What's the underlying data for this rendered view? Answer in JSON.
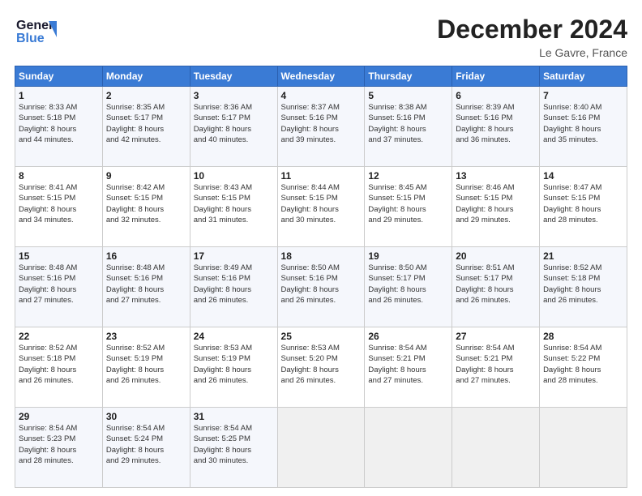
{
  "header": {
    "logo_line1": "General",
    "logo_line2": "Blue",
    "month": "December 2024",
    "location": "Le Gavre, France"
  },
  "days_of_week": [
    "Sunday",
    "Monday",
    "Tuesday",
    "Wednesday",
    "Thursday",
    "Friday",
    "Saturday"
  ],
  "weeks": [
    [
      {
        "day": "1",
        "info": "Sunrise: 8:33 AM\nSunset: 5:18 PM\nDaylight: 8 hours\nand 44 minutes."
      },
      {
        "day": "2",
        "info": "Sunrise: 8:35 AM\nSunset: 5:17 PM\nDaylight: 8 hours\nand 42 minutes."
      },
      {
        "day": "3",
        "info": "Sunrise: 8:36 AM\nSunset: 5:17 PM\nDaylight: 8 hours\nand 40 minutes."
      },
      {
        "day": "4",
        "info": "Sunrise: 8:37 AM\nSunset: 5:16 PM\nDaylight: 8 hours\nand 39 minutes."
      },
      {
        "day": "5",
        "info": "Sunrise: 8:38 AM\nSunset: 5:16 PM\nDaylight: 8 hours\nand 37 minutes."
      },
      {
        "day": "6",
        "info": "Sunrise: 8:39 AM\nSunset: 5:16 PM\nDaylight: 8 hours\nand 36 minutes."
      },
      {
        "day": "7",
        "info": "Sunrise: 8:40 AM\nSunset: 5:16 PM\nDaylight: 8 hours\nand 35 minutes."
      }
    ],
    [
      {
        "day": "8",
        "info": "Sunrise: 8:41 AM\nSunset: 5:15 PM\nDaylight: 8 hours\nand 34 minutes."
      },
      {
        "day": "9",
        "info": "Sunrise: 8:42 AM\nSunset: 5:15 PM\nDaylight: 8 hours\nand 32 minutes."
      },
      {
        "day": "10",
        "info": "Sunrise: 8:43 AM\nSunset: 5:15 PM\nDaylight: 8 hours\nand 31 minutes."
      },
      {
        "day": "11",
        "info": "Sunrise: 8:44 AM\nSunset: 5:15 PM\nDaylight: 8 hours\nand 30 minutes."
      },
      {
        "day": "12",
        "info": "Sunrise: 8:45 AM\nSunset: 5:15 PM\nDaylight: 8 hours\nand 29 minutes."
      },
      {
        "day": "13",
        "info": "Sunrise: 8:46 AM\nSunset: 5:15 PM\nDaylight: 8 hours\nand 29 minutes."
      },
      {
        "day": "14",
        "info": "Sunrise: 8:47 AM\nSunset: 5:15 PM\nDaylight: 8 hours\nand 28 minutes."
      }
    ],
    [
      {
        "day": "15",
        "info": "Sunrise: 8:48 AM\nSunset: 5:16 PM\nDaylight: 8 hours\nand 27 minutes."
      },
      {
        "day": "16",
        "info": "Sunrise: 8:48 AM\nSunset: 5:16 PM\nDaylight: 8 hours\nand 27 minutes."
      },
      {
        "day": "17",
        "info": "Sunrise: 8:49 AM\nSunset: 5:16 PM\nDaylight: 8 hours\nand 26 minutes."
      },
      {
        "day": "18",
        "info": "Sunrise: 8:50 AM\nSunset: 5:16 PM\nDaylight: 8 hours\nand 26 minutes."
      },
      {
        "day": "19",
        "info": "Sunrise: 8:50 AM\nSunset: 5:17 PM\nDaylight: 8 hours\nand 26 minutes."
      },
      {
        "day": "20",
        "info": "Sunrise: 8:51 AM\nSunset: 5:17 PM\nDaylight: 8 hours\nand 26 minutes."
      },
      {
        "day": "21",
        "info": "Sunrise: 8:52 AM\nSunset: 5:18 PM\nDaylight: 8 hours\nand 26 minutes."
      }
    ],
    [
      {
        "day": "22",
        "info": "Sunrise: 8:52 AM\nSunset: 5:18 PM\nDaylight: 8 hours\nand 26 minutes."
      },
      {
        "day": "23",
        "info": "Sunrise: 8:52 AM\nSunset: 5:19 PM\nDaylight: 8 hours\nand 26 minutes."
      },
      {
        "day": "24",
        "info": "Sunrise: 8:53 AM\nSunset: 5:19 PM\nDaylight: 8 hours\nand 26 minutes."
      },
      {
        "day": "25",
        "info": "Sunrise: 8:53 AM\nSunset: 5:20 PM\nDaylight: 8 hours\nand 26 minutes."
      },
      {
        "day": "26",
        "info": "Sunrise: 8:54 AM\nSunset: 5:21 PM\nDaylight: 8 hours\nand 27 minutes."
      },
      {
        "day": "27",
        "info": "Sunrise: 8:54 AM\nSunset: 5:21 PM\nDaylight: 8 hours\nand 27 minutes."
      },
      {
        "day": "28",
        "info": "Sunrise: 8:54 AM\nSunset: 5:22 PM\nDaylight: 8 hours\nand 28 minutes."
      }
    ],
    [
      {
        "day": "29",
        "info": "Sunrise: 8:54 AM\nSunset: 5:23 PM\nDaylight: 8 hours\nand 28 minutes."
      },
      {
        "day": "30",
        "info": "Sunrise: 8:54 AM\nSunset: 5:24 PM\nDaylight: 8 hours\nand 29 minutes."
      },
      {
        "day": "31",
        "info": "Sunrise: 8:54 AM\nSunset: 5:25 PM\nDaylight: 8 hours\nand 30 minutes."
      },
      {
        "day": "",
        "info": ""
      },
      {
        "day": "",
        "info": ""
      },
      {
        "day": "",
        "info": ""
      },
      {
        "day": "",
        "info": ""
      }
    ]
  ]
}
